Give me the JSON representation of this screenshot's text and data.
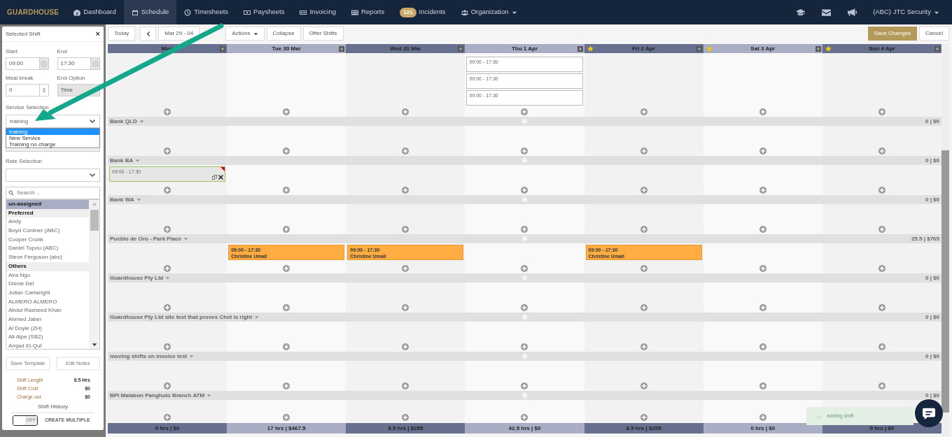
{
  "brand": "GUARDHOUSE",
  "nav": [
    {
      "label": "Dashboard",
      "selected": false
    },
    {
      "label": "Schedule",
      "selected": true
    },
    {
      "label": "Timesheets",
      "selected": false
    },
    {
      "label": "Paysheets",
      "selected": false
    },
    {
      "label": "Invoicing",
      "selected": false
    },
    {
      "label": "Reports",
      "selected": false
    },
    {
      "label": "Incidents",
      "badge": "121",
      "selected": false
    },
    {
      "label": "Organization",
      "dropdown": true,
      "selected": false
    }
  ],
  "user_menu": {
    "label": "(ABC) JTC Security"
  },
  "panel": {
    "title": "Selected Shift",
    "close": "×",
    "fields": [
      {
        "label": "Start",
        "value": "09:00",
        "kind": "time",
        "disabled": false
      },
      {
        "label": "End",
        "value": "17:30",
        "kind": "time",
        "disabled": false
      },
      {
        "label": "Meal break",
        "value": "0",
        "kind": "number",
        "disabled": false
      },
      {
        "label": "End Option",
        "value": "Time",
        "kind": "select",
        "disabled": true
      }
    ],
    "service": {
      "label": "Service Selection",
      "value": "training",
      "options": [
        {
          "label": "training",
          "selected": true
        },
        {
          "label": "New Service",
          "selected": false
        },
        {
          "label": "Training no charge",
          "selected": false
        }
      ]
    },
    "rate": {
      "label": "Rate Selection"
    },
    "search": {
      "placeholder": "Search ..."
    },
    "people": [
      {
        "label": "un-assigned",
        "kind": "item",
        "selected": true
      },
      {
        "label": "Preferred",
        "kind": "header",
        "selected": false
      },
      {
        "label": "Andy",
        "kind": "item",
        "selected": false
      },
      {
        "label": "Boyd Cordner (ABC)",
        "kind": "item",
        "selected": false
      },
      {
        "label": "Cooper Cronk",
        "kind": "item",
        "selected": false
      },
      {
        "label": "Daniel Tupou (ABC)",
        "kind": "item",
        "selected": false
      },
      {
        "label": "Steve Ferguson (abc)",
        "kind": "item",
        "selected": false
      },
      {
        "label": "Others",
        "kind": "header",
        "selected": false
      },
      {
        "label": "Aira Ngo",
        "kind": "item",
        "selected": false
      },
      {
        "label": "Disnie Del",
        "kind": "item",
        "selected": false
      },
      {
        "label": "Julian Cartwright",
        "kind": "item",
        "selected": false
      },
      {
        "label": "ALMERO ALMERO",
        "kind": "item",
        "selected": false
      },
      {
        "label": "Abdul Rasheed Khan",
        "kind": "item",
        "selected": false
      },
      {
        "label": "Ahmed Jaber",
        "kind": "item",
        "selected": false
      },
      {
        "label": "Al Doyle (ZH)",
        "kind": "item",
        "selected": false
      },
      {
        "label": "Ali Alpe (SB2)",
        "kind": "item",
        "selected": false
      },
      {
        "label": "Amjad El-Qut",
        "kind": "item",
        "selected": false
      }
    ],
    "buttons": [
      "Save Template",
      "Edit Notes"
    ],
    "stats": [
      {
        "label": "Shift Length",
        "value": "8.5 Hrs"
      },
      {
        "label": "Shift Cost",
        "value": "$0"
      },
      {
        "label": "Charge out",
        "value": "$0"
      }
    ],
    "history": "Shift History",
    "toggle": {
      "label": "CREATE MULTIPLE",
      "state_text": "OFF",
      "on": false
    }
  },
  "toolbar": {
    "left": [
      {
        "label": "Today",
        "kind": "text"
      },
      {
        "kind": "prev"
      },
      {
        "label": "Mar 29 - 04",
        "kind": "text"
      },
      {
        "label": "Actions",
        "kind": "dropdown"
      },
      {
        "label": "Collapse",
        "kind": "text"
      },
      {
        "label": "Offer Shifts",
        "kind": "text"
      }
    ],
    "right": [
      {
        "label": "Save Changes",
        "kind": "primary"
      },
      {
        "label": "Cancel",
        "kind": "text"
      }
    ]
  },
  "days": [
    {
      "label": "Mon",
      "starred": false
    },
    {
      "label": "Tue 30 Mar",
      "starred": false
    },
    {
      "label": "Wed 31 Mar",
      "starred": false
    },
    {
      "label": "Thu 1 Apr",
      "starred": false
    },
    {
      "label": "Fri 2 Apr",
      "starred": true
    },
    {
      "label": "Sat 3 Apr",
      "starred": true
    },
    {
      "label": "Sun 4 Apr",
      "starred": true
    }
  ],
  "groups": [
    {
      "cells": [
        {},
        {},
        {},
        {
          "shifts": [
            {
              "time": "09:00 - 17:30",
              "kind": "open",
              "selected": false
            },
            {
              "time": "09:00 - 17:30",
              "kind": "open",
              "selected": false
            },
            {
              "time": "09:00 - 17:30",
              "kind": "open",
              "selected": false
            }
          ]
        },
        {},
        {},
        {}
      ]
    },
    {
      "name": "Bank QLD",
      "total": "0 | $0",
      "cells": [
        {},
        {},
        {},
        {},
        {},
        {},
        {}
      ]
    },
    {
      "name": "Bank BA",
      "total": "0 | $0",
      "cells": [
        {
          "shifts": [
            {
              "time": "09:00 - 17:30",
              "kind": "open",
              "selected": true
            }
          ]
        },
        {},
        {},
        {},
        {},
        {},
        {}
      ]
    },
    {
      "name": "Bank WA",
      "total": "0 | $0",
      "cells": [
        {},
        {},
        {},
        {},
        {},
        {},
        {}
      ]
    },
    {
      "name": "Pueblo de Oro - Park Place",
      "total": "25.5 | $765",
      "cells": [
        {},
        {
          "shifts": [
            {
              "time": "09:00 - 17:30",
              "employee": "Christine Umali",
              "kind": "assigned",
              "selected": false
            }
          ]
        },
        {
          "shifts": [
            {
              "time": "09:00 - 17:30",
              "employee": "Christine Umali",
              "kind": "assigned",
              "selected": false
            }
          ]
        },
        {},
        {
          "shifts": [
            {
              "time": "09:00 - 17:30",
              "employee": "Christine Umali",
              "kind": "assigned",
              "selected": false
            }
          ]
        },
        {},
        {}
      ]
    },
    {
      "name": "Guardhouse Pty Ltd",
      "total": "0 | $0",
      "cells": [
        {},
        {},
        {},
        {},
        {},
        {},
        {}
      ]
    },
    {
      "name": "Guardhouse Pty Ltd site test that proves Chet is right",
      "total": "0 | $0",
      "cells": [
        {},
        {},
        {},
        {},
        {},
        {},
        {}
      ]
    },
    {
      "name": "moving shifts on invoice test",
      "total": "0 | $0",
      "cells": [
        {},
        {},
        {},
        {},
        {},
        {},
        {}
      ]
    },
    {
      "name": "BPI Malabon Panghulo Branch ATM",
      "total": "0 | $0",
      "cells": [
        {},
        {},
        {},
        {},
        {},
        {},
        {}
      ]
    }
  ],
  "totals": [
    "0 hrs | $0",
    "17 hrs | $467.5",
    "8.5 hrs | $255",
    "42.5 hrs | $0",
    "8.5 hrs | $255",
    "0 hrs | $0",
    "0 hrs | $0"
  ],
  "toast": {
    "text": "adding shift"
  }
}
